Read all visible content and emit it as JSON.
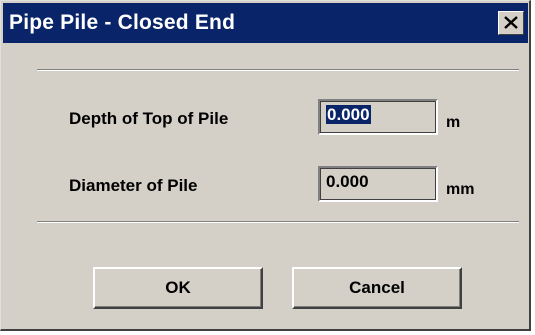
{
  "window": {
    "title": "Pipe Pile - Closed End",
    "close_icon": "close-icon"
  },
  "fields": [
    {
      "label": "Depth of Top of Pile",
      "value": "0.000",
      "unit": "m",
      "focused": true
    },
    {
      "label": "Diameter of Pile",
      "value": "0.000",
      "unit": "mm",
      "focused": false
    }
  ],
  "buttons": {
    "ok": "OK",
    "cancel": "Cancel"
  },
  "colors": {
    "title_bar": "#0a246a",
    "face": "#d4d0c8",
    "selection": "#0a246a"
  }
}
